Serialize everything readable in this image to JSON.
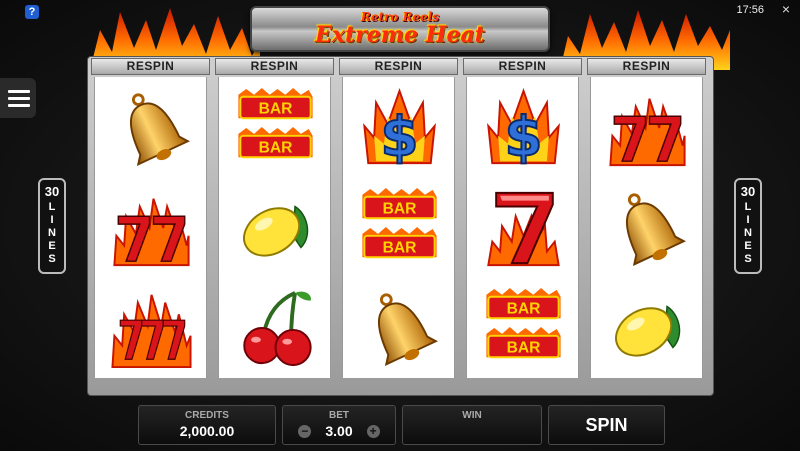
{
  "header": {
    "logo_sub": "Retro Reels",
    "logo_main": "Extreme Heat",
    "help_label": "?",
    "clock": "17:56",
    "close_label": "×"
  },
  "lines_badge": {
    "count": "30",
    "label": "LINES"
  },
  "reels": [
    {
      "respin": "RESPIN",
      "symbols": [
        "bell",
        "flaming-seven-double",
        "flaming-seven-triple"
      ]
    },
    {
      "respin": "RESPIN",
      "symbols": [
        "double-bar",
        "lemon",
        "cherries"
      ]
    },
    {
      "respin": "RESPIN",
      "symbols": [
        "flaming-dollar",
        "double-bar",
        "bell"
      ]
    },
    {
      "respin": "RESPIN",
      "symbols": [
        "flaming-dollar",
        "flaming-seven",
        "double-bar"
      ]
    },
    {
      "respin": "RESPIN",
      "symbols": [
        "flaming-seven-double",
        "bell",
        "lemon"
      ]
    }
  ],
  "bottom": {
    "credits_label": "CREDITS",
    "credits_value": "2,000.00",
    "bet_label": "BET",
    "bet_value": "3.00",
    "bet_minus": "−",
    "bet_plus": "+",
    "win_label": "WIN",
    "win_value": "",
    "spin_label": "SPIN"
  },
  "colors": {
    "flame": "#ff6a00",
    "gold": "#e8a21a",
    "red": "#d9141b",
    "blue": "#2f6fd8"
  }
}
